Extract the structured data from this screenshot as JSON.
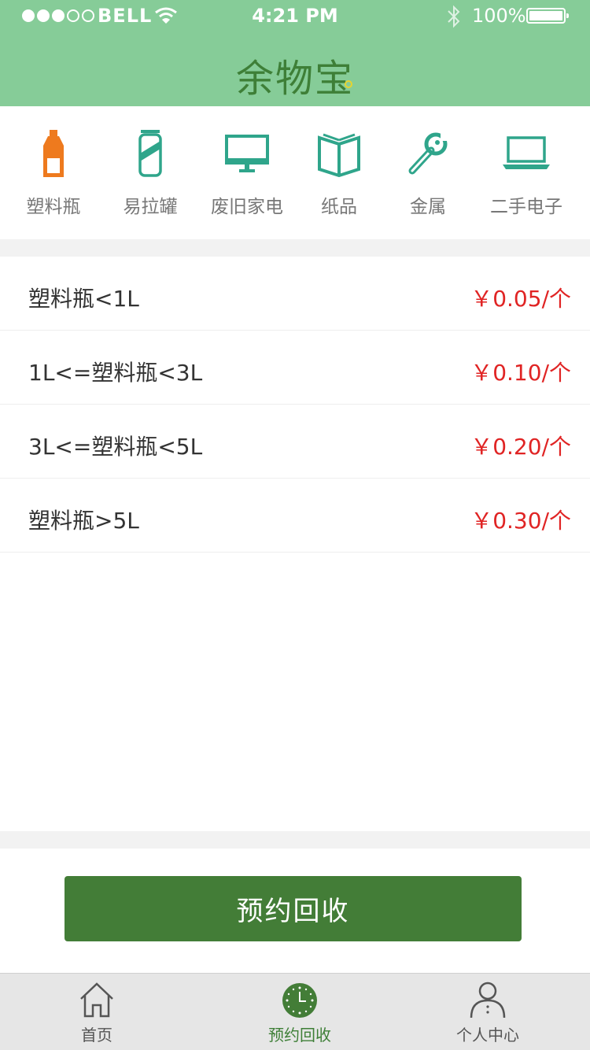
{
  "status_bar": {
    "carrier": "BELL",
    "time": "4:21 PM",
    "battery": "100%",
    "signal_strength": 3,
    "signal_total": 5
  },
  "header": {
    "logo": "余物宝"
  },
  "categories": [
    {
      "label": "塑料瓶",
      "icon": "plastic-bottle-icon",
      "color": "#ee7a1e",
      "active": true
    },
    {
      "label": "易拉罐",
      "icon": "can-icon",
      "color": "#2fa58b",
      "active": false
    },
    {
      "label": "废旧家电",
      "icon": "monitor-icon",
      "color": "#2fa58b",
      "active": false
    },
    {
      "label": "纸品",
      "icon": "book-icon",
      "color": "#2fa58b",
      "active": false
    },
    {
      "label": "金属",
      "icon": "wrench-icon",
      "color": "#2fa58b",
      "active": false
    },
    {
      "label": "二手电子",
      "icon": "laptop-icon",
      "color": "#2fa58b",
      "active": false
    }
  ],
  "prices": [
    {
      "name": "塑料瓶<1L",
      "price": "￥0.05/个"
    },
    {
      "name": "1L<=塑料瓶<3L",
      "price": "￥0.10/个"
    },
    {
      "name": "3L<=塑料瓶<5L",
      "price": "￥0.20/个"
    },
    {
      "name": "塑料瓶>5L",
      "price": "￥0.30/个"
    }
  ],
  "action": {
    "label": "预约回收"
  },
  "tabs": [
    {
      "label": "首页",
      "icon": "home-icon",
      "active": false
    },
    {
      "label": "预约回收",
      "icon": "clock-icon",
      "active": true
    },
    {
      "label": "个人中心",
      "icon": "person-icon",
      "active": false
    }
  ],
  "colors": {
    "header": "#86cc98",
    "brand_green": "#437d37",
    "accent_teal": "#2fa58b",
    "active_orange": "#ee7a1e",
    "price_red": "#e02424"
  }
}
